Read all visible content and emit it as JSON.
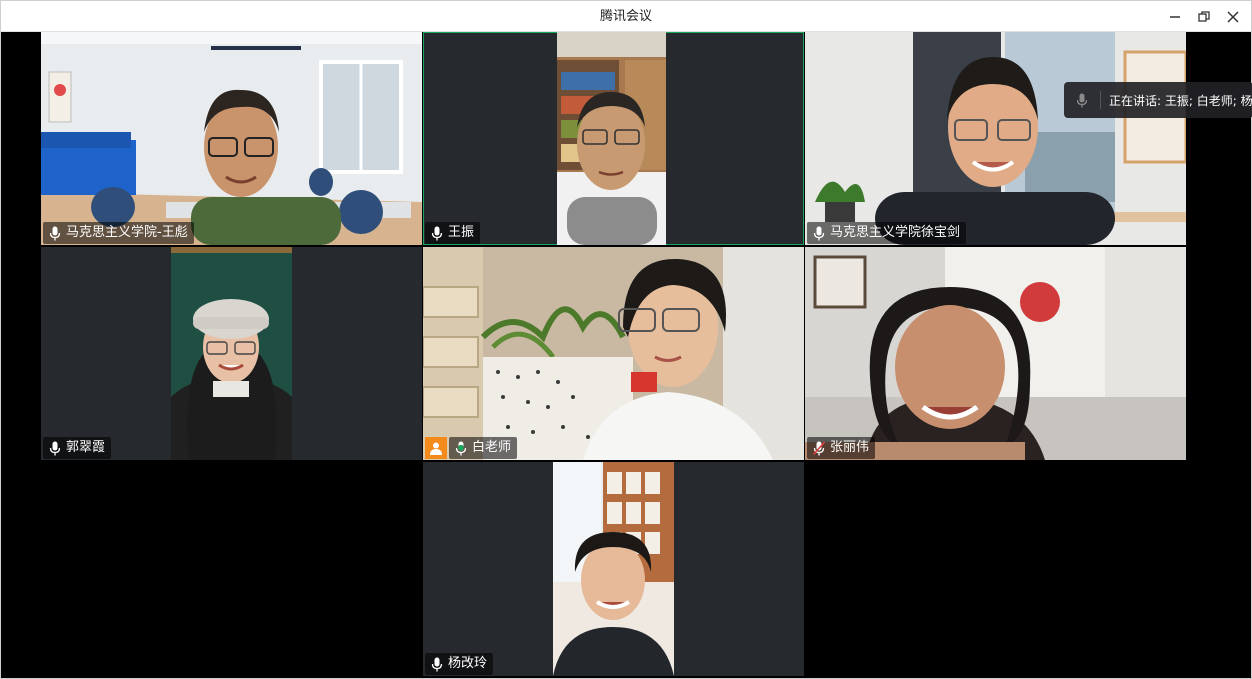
{
  "window": {
    "title": "腾讯会议"
  },
  "speaking": {
    "label": "正在讲话: 王振; 白老师; 杨"
  },
  "participants": [
    {
      "name": "马克思主义学院-王彪"
    },
    {
      "name": "王振"
    },
    {
      "name": "马克思主义学院徐宝剑"
    },
    {
      "name": "郭翠霞"
    },
    {
      "name": "白老师"
    },
    {
      "name": "张丽伟"
    },
    {
      "name": "杨改玲"
    }
  ],
  "colors": {
    "accent_green": "#1aa55c",
    "host_orange": "#f28a1c",
    "muted_red": "#e04040",
    "tile_bg": "#26292e"
  }
}
